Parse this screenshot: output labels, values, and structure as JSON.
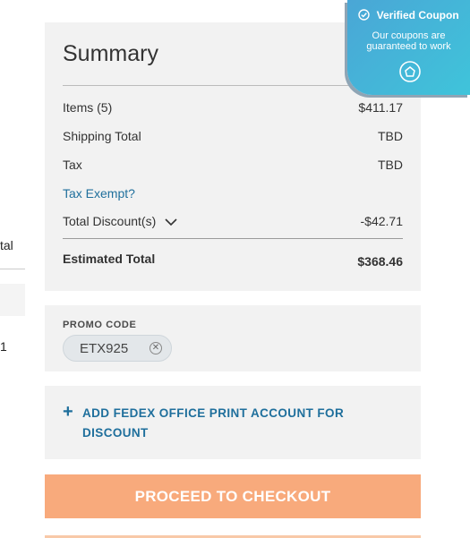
{
  "left_fragment": {
    "label": "tal",
    "value": "1"
  },
  "summary": {
    "title": "Summary",
    "items_label": "Items (5)",
    "items_value": "$411.17",
    "shipping_label": "Shipping Total",
    "shipping_value": "TBD",
    "tax_label": "Tax",
    "tax_value": "TBD",
    "tax_exempt_link": "Tax Exempt?",
    "discount_label": "Total Discount(s)",
    "discount_value": "-$42.71",
    "estimated_label": "Estimated Total",
    "estimated_value": "$368.46"
  },
  "badge": {
    "title": "Verified Coupon",
    "subtitle": "Our coupons are guaranteed to work",
    "colors": {
      "start": "#4aa6d6",
      "end": "#3fc4da"
    },
    "icons": [
      "check-circle-icon",
      "coupon-logo-icon"
    ]
  },
  "promo": {
    "label": "PROMO CODE",
    "code": "ETX925",
    "remove_icon": "close-circle-icon"
  },
  "fedex": {
    "plus_icon": "+",
    "label": "ADD FEDEX OFFICE PRINT ACCOUNT FOR DISCOUNT"
  },
  "checkout": {
    "label": "PROCEED TO CHECKOUT",
    "color": "#f8aa7c"
  },
  "colors": {
    "link": "#1f6f9c",
    "panel_bg": "#f2f2f2"
  }
}
